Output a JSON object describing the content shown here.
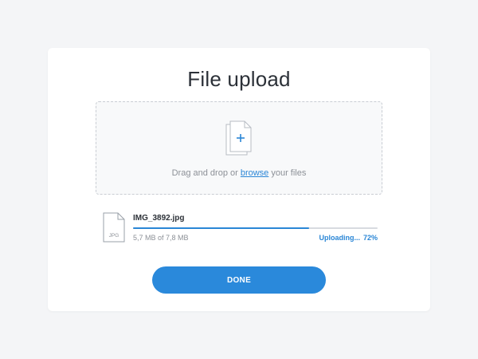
{
  "dialog": {
    "title": "File upload"
  },
  "dropzone": {
    "text_before": "Drag and drop or ",
    "link_text": "browse",
    "text_after": " your files",
    "icon": "files-add-icon"
  },
  "upload": {
    "file_name": "IMG_3892.jpg",
    "file_type_label": "JPG",
    "file_icon": "jpg-file-icon",
    "size_text": "5,7 MB of 7,8 MB",
    "status_text": "Uploading...",
    "percent_text": "72%",
    "progress": 0.72
  },
  "actions": {
    "done_label": "DONE"
  },
  "colors": {
    "accent": "#2a86d6",
    "button": "#2a89db",
    "background": "#f4f5f7",
    "card": "#ffffff"
  }
}
